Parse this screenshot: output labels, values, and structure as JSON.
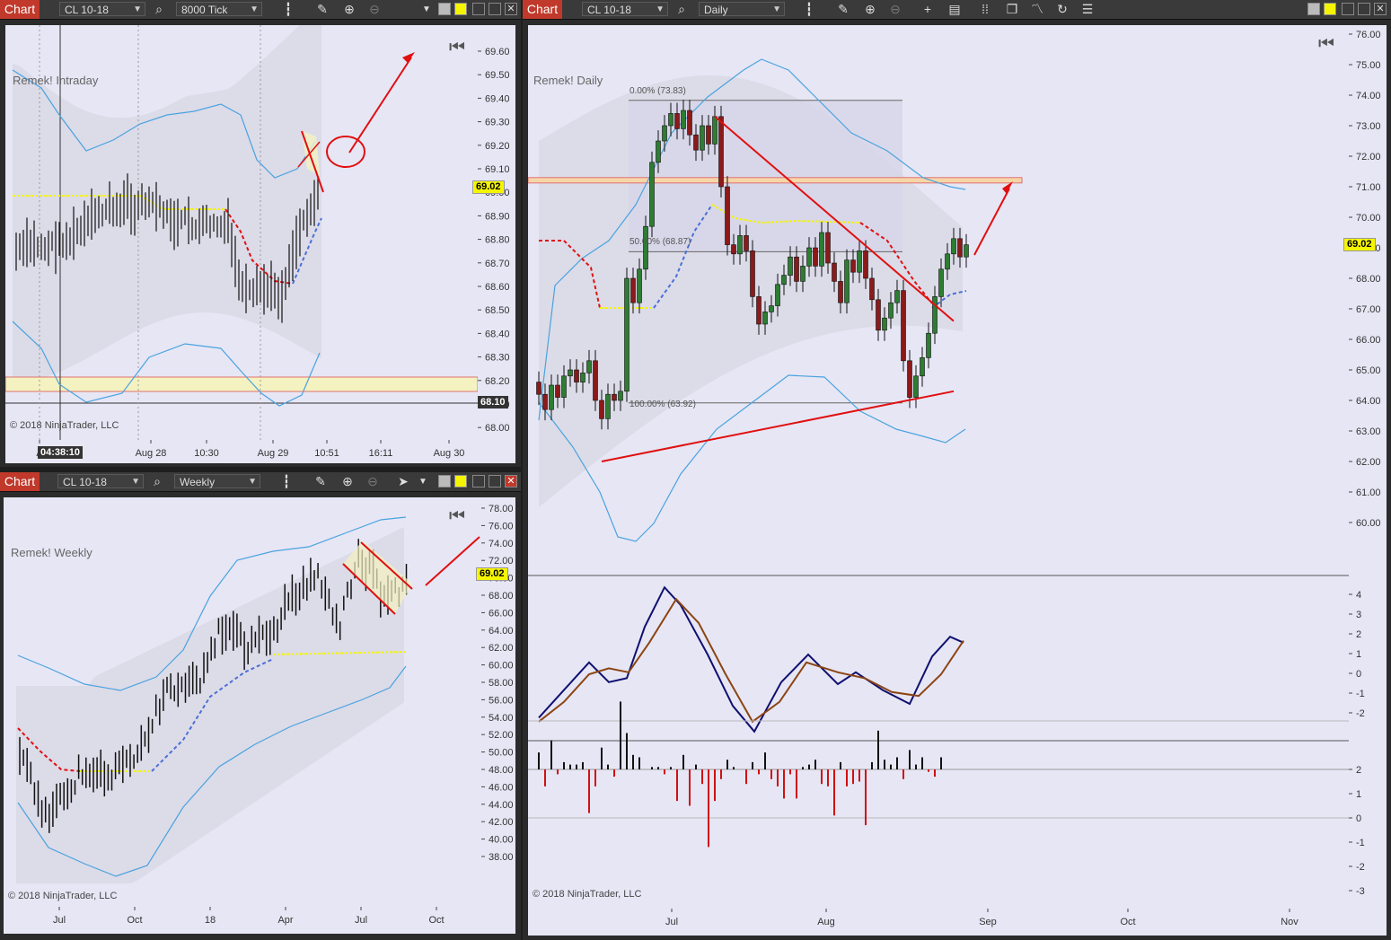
{
  "colors": {
    "bg": "#e7e6f5",
    "red": "#e01010",
    "yellow": "#f5f500",
    "blue": "#4aa3df",
    "accent": "#c0392b",
    "olive": "#8b4513",
    "navy": "#101070"
  },
  "windows": [
    {
      "id": "intraday",
      "chart_label": "Chart",
      "symbol": "CL 10-18",
      "interval": "8000 Tick",
      "indicator_label": "Remek! Intraday",
      "copyright": "© 2018 NinjaTrader, LLC",
      "last_price": "69.02",
      "crosshair_price": "68.10",
      "time_tag": "04:38:10",
      "y_ticks": [
        "69.60",
        "69.50",
        "69.40",
        "69.30",
        "69.20",
        "69.10",
        "69.00",
        "68.90",
        "68.80",
        "68.70",
        "68.60",
        "68.50",
        "68.40",
        "68.30",
        "68.20",
        "68.10",
        "68.00"
      ],
      "x_ticks": [
        "A",
        "Aug 28",
        "10:30",
        "Aug 29",
        "10:51",
        "16:11",
        "Aug 30"
      ]
    },
    {
      "id": "weekly",
      "chart_label": "Chart",
      "symbol": "CL 10-18",
      "interval": "Weekly",
      "indicator_label": "Remek! Weekly",
      "copyright": "© 2018 NinjaTrader, LLC",
      "last_price": "69.02",
      "y_ticks": [
        "78.00",
        "76.00",
        "74.00",
        "72.00",
        "70.00",
        "68.00",
        "66.00",
        "64.00",
        "62.00",
        "60.00",
        "58.00",
        "56.00",
        "54.00",
        "52.00",
        "50.00",
        "48.00",
        "46.00",
        "44.00",
        "42.00",
        "40.00",
        "38.00"
      ],
      "x_ticks": [
        "Jul",
        "Oct",
        "18",
        "Apr",
        "Jul",
        "Oct"
      ]
    },
    {
      "id": "daily",
      "chart_label": "Chart",
      "symbol": "CL 10-18",
      "interval": "Daily",
      "indicator_label": "Remek! Daily",
      "copyright": "© 2018 NinjaTrader, LLC",
      "last_price": "69.02",
      "y_ticks": [
        "76.00",
        "75.00",
        "74.00",
        "73.00",
        "72.00",
        "71.00",
        "70.00",
        "69.00",
        "68.00",
        "67.00",
        "66.00",
        "65.00",
        "64.00",
        "63.00",
        "62.00",
        "61.00",
        "60.00"
      ],
      "osc_ticks": [
        "4",
        "3",
        "2",
        "1",
        "0",
        "-1",
        "-2"
      ],
      "hist_ticks": [
        "2",
        "1",
        "0",
        "-1",
        "-2",
        "-3"
      ],
      "x_ticks": [
        "Jul",
        "Aug",
        "Sep",
        "Oct",
        "Nov"
      ],
      "fib": [
        "0.00% (73.83)",
        "50.00% (68.87)",
        "100.00% (63.92)"
      ]
    }
  ]
}
